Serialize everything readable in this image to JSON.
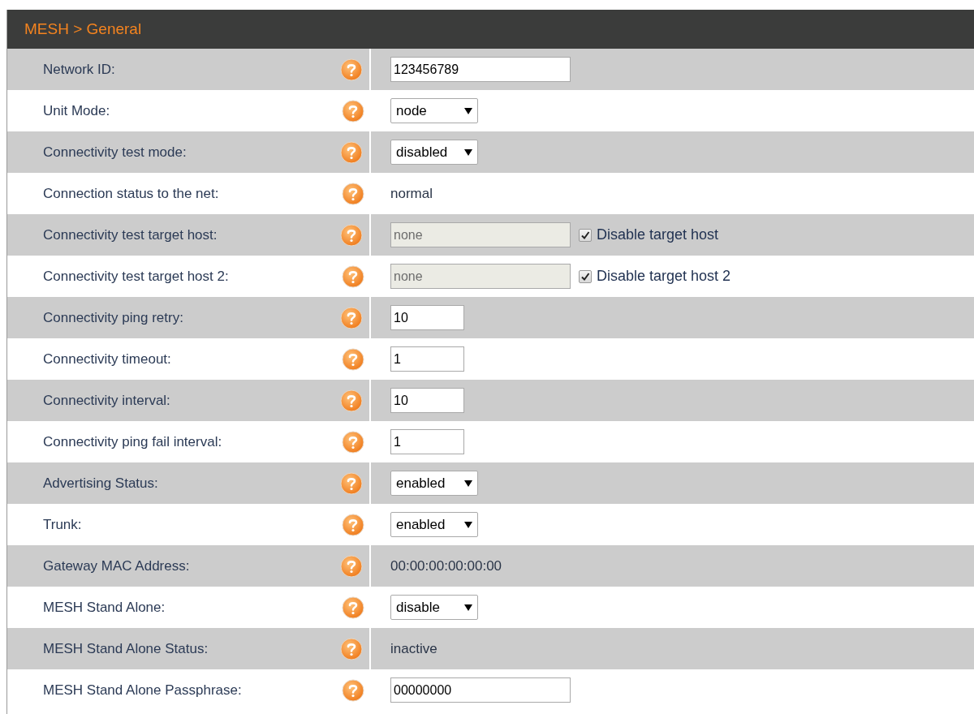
{
  "header": {
    "title": "MESH > General"
  },
  "fields": [
    {
      "label": "Network ID:",
      "kind": "text",
      "value": "123456789",
      "disabled": false
    },
    {
      "label": "Unit Mode:",
      "kind": "select",
      "value": "node"
    },
    {
      "label": "Connectivity test mode:",
      "kind": "select",
      "value": "disabled"
    },
    {
      "label": "Connection status to the net:",
      "kind": "static",
      "value": "normal"
    },
    {
      "label": "Connectivity test target host:",
      "kind": "text",
      "value": "none",
      "disabled": true,
      "checkbox": {
        "label": "Disable target host",
        "checked": true
      }
    },
    {
      "label": "Connectivity test target host 2:",
      "kind": "text",
      "value": "none",
      "disabled": true,
      "checkbox": {
        "label": "Disable target host 2",
        "checked": true
      }
    },
    {
      "label": "Connectivity ping retry:",
      "kind": "number",
      "value": "10",
      "disabled": false
    },
    {
      "label": "Connectivity timeout:",
      "kind": "number",
      "value": "1",
      "disabled": false
    },
    {
      "label": "Connectivity interval:",
      "kind": "number",
      "value": "10",
      "disabled": false
    },
    {
      "label": "Connectivity ping fail interval:",
      "kind": "number",
      "value": "1",
      "disabled": false
    },
    {
      "label": "Advertising Status:",
      "kind": "select",
      "value": "enabled"
    },
    {
      "label": "Trunk:",
      "kind": "select",
      "value": "enabled"
    },
    {
      "label": "Gateway MAC Address:",
      "kind": "static",
      "value": "00:00:00:00:00:00"
    },
    {
      "label": "MESH Stand Alone:",
      "kind": "select",
      "value": "disable"
    },
    {
      "label": "MESH Stand Alone Status:",
      "kind": "static",
      "value": "inactive"
    },
    {
      "label": "MESH Stand Alone Passphrase:",
      "kind": "text",
      "value": "00000000",
      "disabled": false
    }
  ]
}
